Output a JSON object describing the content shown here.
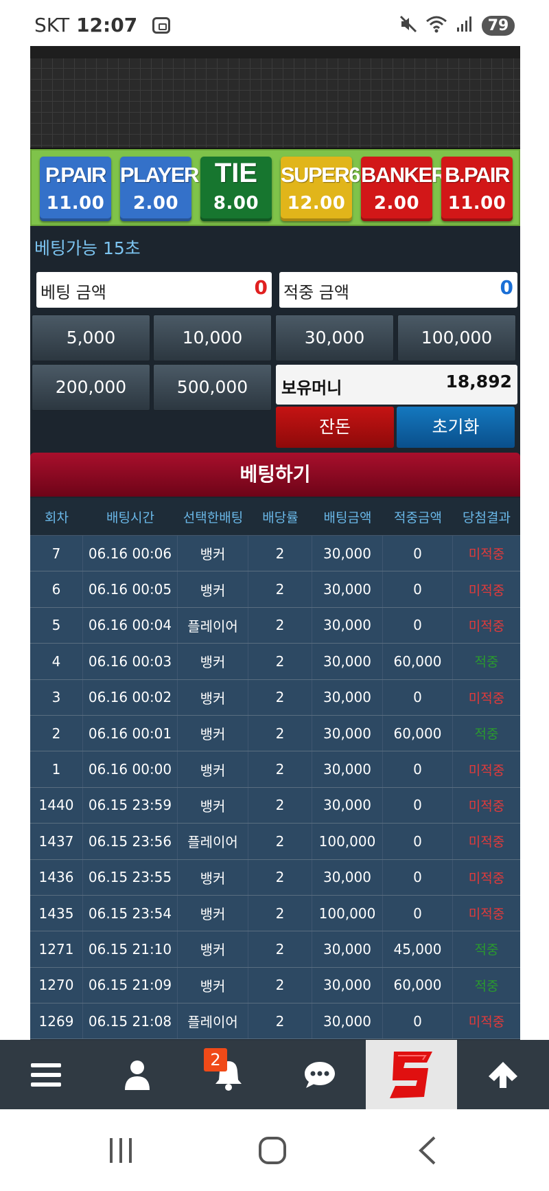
{
  "status_bar": {
    "carrier": "SKT",
    "time": "12:07",
    "battery": "79",
    "icons": [
      "screenshot-icon",
      "mute-icon",
      "wifi-icon",
      "signal-icon"
    ]
  },
  "bet_options": [
    {
      "name": "P.PAIR",
      "odds": "11.00",
      "color": "#3471c9"
    },
    {
      "name": "PLAYER",
      "odds": "2.00",
      "color": "#3471c9"
    },
    {
      "name": "TIE",
      "odds": "8.00",
      "color": "#17762f"
    },
    {
      "name": "SUPER6",
      "odds": "12.00",
      "color": "#e1b51a"
    },
    {
      "name": "BANKER",
      "odds": "2.00",
      "color": "#d21718"
    },
    {
      "name": "B.PAIR",
      "odds": "11.00",
      "color": "#d21718"
    }
  ],
  "timer": {
    "label": "베팅가능",
    "value": "15초"
  },
  "bet_amount": {
    "label": "베팅 금액",
    "value": "0",
    "color": "#e02020"
  },
  "win_amount": {
    "label": "적중 금액",
    "value": "0",
    "color": "#1a6fd6"
  },
  "chips": [
    "5,000",
    "10,000",
    "30,000",
    "100,000",
    "200,000",
    "500,000"
  ],
  "balance": {
    "label": "보유머니",
    "value": "18,892"
  },
  "actions": {
    "change": "잔돈",
    "reset": "초기화",
    "place_bet": "베팅하기"
  },
  "history": {
    "columns": [
      "회차",
      "배팅시간",
      "선택한배팅",
      "배당률",
      "배팅금액",
      "적중금액",
      "당첨결과"
    ],
    "rows": [
      [
        "7",
        "06.16 00:06",
        "뱅커",
        "2",
        "30,000",
        "0",
        "미적중"
      ],
      [
        "6",
        "06.16 00:05",
        "뱅커",
        "2",
        "30,000",
        "0",
        "미적중"
      ],
      [
        "5",
        "06.16 00:04",
        "플레이어",
        "2",
        "30,000",
        "0",
        "미적중"
      ],
      [
        "4",
        "06.16 00:03",
        "뱅커",
        "2",
        "30,000",
        "60,000",
        "적중"
      ],
      [
        "3",
        "06.16 00:02",
        "뱅커",
        "2",
        "30,000",
        "0",
        "미적중"
      ],
      [
        "2",
        "06.16 00:01",
        "뱅커",
        "2",
        "30,000",
        "60,000",
        "적중"
      ],
      [
        "1",
        "06.16 00:00",
        "뱅커",
        "2",
        "30,000",
        "0",
        "미적중"
      ],
      [
        "1440",
        "06.15 23:59",
        "뱅커",
        "2",
        "30,000",
        "0",
        "미적중"
      ],
      [
        "1437",
        "06.15 23:56",
        "플레이어",
        "2",
        "100,000",
        "0",
        "미적중"
      ],
      [
        "1436",
        "06.15 23:55",
        "뱅커",
        "2",
        "30,000",
        "0",
        "미적중"
      ],
      [
        "1435",
        "06.15 23:54",
        "뱅커",
        "2",
        "100,000",
        "0",
        "미적중"
      ],
      [
        "1271",
        "06.15 21:10",
        "뱅커",
        "2",
        "30,000",
        "45,000",
        "적중"
      ],
      [
        "1270",
        "06.15 21:09",
        "뱅커",
        "2",
        "30,000",
        "60,000",
        "적중"
      ],
      [
        "1269",
        "06.15 21:08",
        "플레이어",
        "2",
        "30,000",
        "0",
        "미적중"
      ]
    ]
  },
  "app_nav": {
    "items": [
      "menu-icon",
      "user-icon",
      "bell-icon",
      "chat-icon",
      "logo",
      "arrow-up-icon"
    ],
    "notification_count": "2"
  },
  "system_nav": [
    "recents-icon",
    "home-icon",
    "back-icon"
  ]
}
